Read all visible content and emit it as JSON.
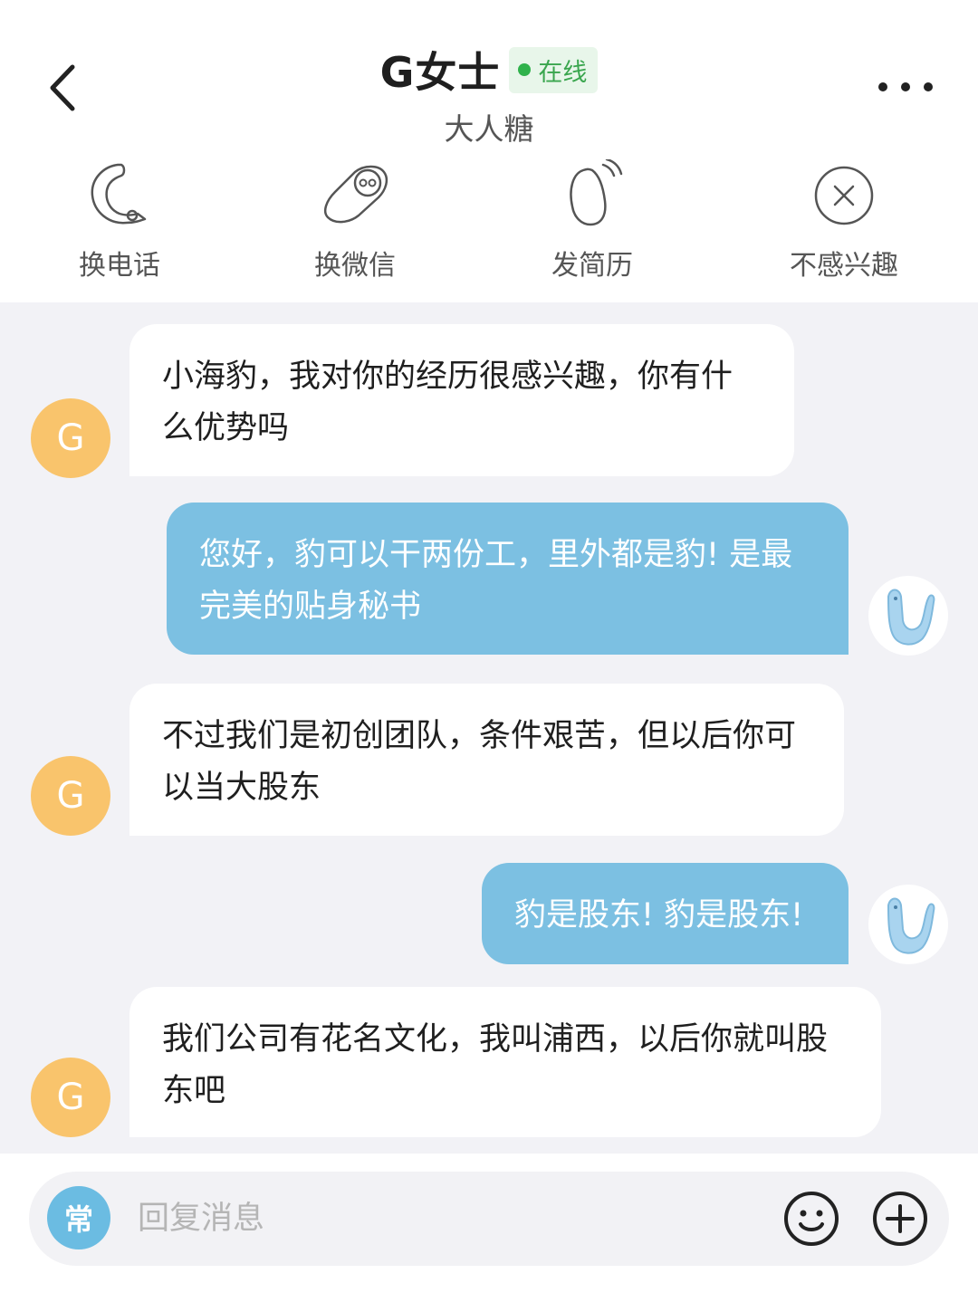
{
  "header": {
    "contact_name": "G女士",
    "status": "在线",
    "company": "大人糖",
    "colors": {
      "online_green": "#2fb24b",
      "badge_bg": "#e8f6ea"
    }
  },
  "actions": [
    {
      "label": "换电话",
      "icon": "phone-icon"
    },
    {
      "label": "换微信",
      "icon": "wechat-icon"
    },
    {
      "label": "发简历",
      "icon": "resume-icon"
    },
    {
      "label": "不感兴趣",
      "icon": "not-interested-icon"
    }
  ],
  "messages": [
    {
      "from": "contact",
      "avatar": "G",
      "text": "小海豹，我对你的经历很感兴趣，你有什么优势吗"
    },
    {
      "from": "me",
      "avatar": "seal-avatar",
      "text": "您好，豹可以干两份工，里外都是豹! 是最完美的贴身秘书"
    },
    {
      "from": "contact",
      "avatar": "G",
      "text": "不过我们是初创团队，条件艰苦，但以后你可以当大股东"
    },
    {
      "from": "me",
      "avatar": "seal-avatar",
      "text": "豹是股东! 豹是股东!"
    },
    {
      "from": "contact",
      "avatar": "G",
      "text": "我们公司有花名文化，我叫浦西，以后你就叫股东吧"
    }
  ],
  "input": {
    "quick_reply_label": "常",
    "placeholder": "回复消息"
  },
  "colors": {
    "chat_bg": "#f2f2f6",
    "outgoing_bubble": "#7cc0e2",
    "incoming_bubble": "#ffffff",
    "contact_avatar": "#f9c46c",
    "quick_button": "#6bbce2"
  }
}
